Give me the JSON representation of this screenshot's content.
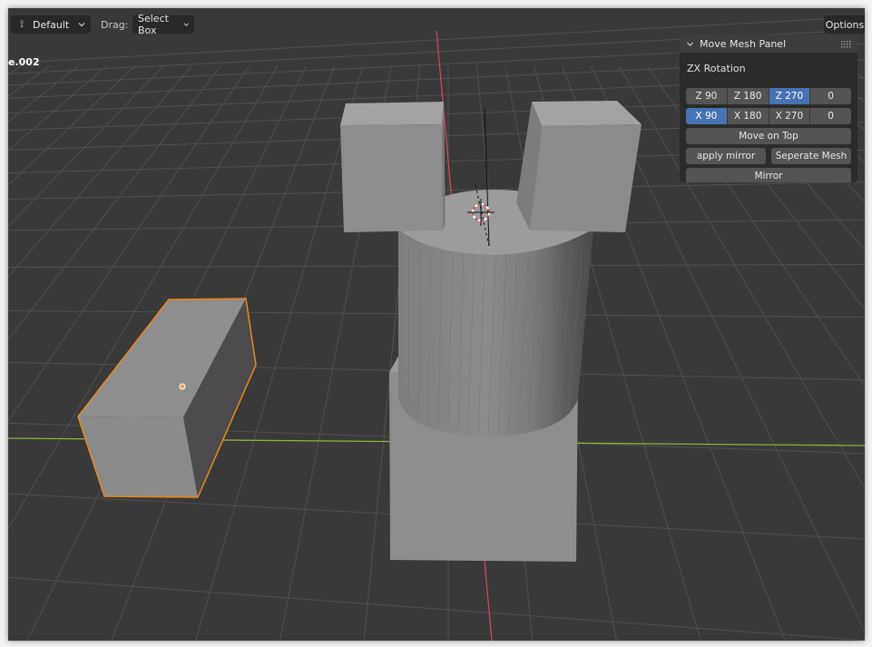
{
  "header": {
    "mode_icon": "transform-pivot-icon",
    "mode_label": "Default",
    "drag_label": "Drag:",
    "drag_value": "Select Box",
    "options_label": "Options"
  },
  "viewport": {
    "object_label": "e.002",
    "colors": {
      "background": "#393939",
      "grid": "#4f4f4f",
      "x_axis": "#8cb23a",
      "y_axis": "#d84a55",
      "selection_outline": "#e8891a"
    }
  },
  "panel": {
    "title": "Move Mesh Panel",
    "section_label": "ZX Rotation",
    "z_rotation": [
      {
        "label": "Z 90",
        "active": false
      },
      {
        "label": "Z 180",
        "active": false
      },
      {
        "label": "Z 270",
        "active": true
      },
      {
        "label": "0",
        "active": false
      }
    ],
    "x_rotation": [
      {
        "label": "X 90",
        "active": true
      },
      {
        "label": "X 180",
        "active": false
      },
      {
        "label": "X 270",
        "active": false
      },
      {
        "label": "0",
        "active": false
      }
    ],
    "move_on_top_label": "Move on Top",
    "apply_mirror_label": "apply mirror",
    "separate_mesh_label": "Seperate Mesh",
    "mirror_label": "Mirror",
    "accent": "#4772b3"
  }
}
